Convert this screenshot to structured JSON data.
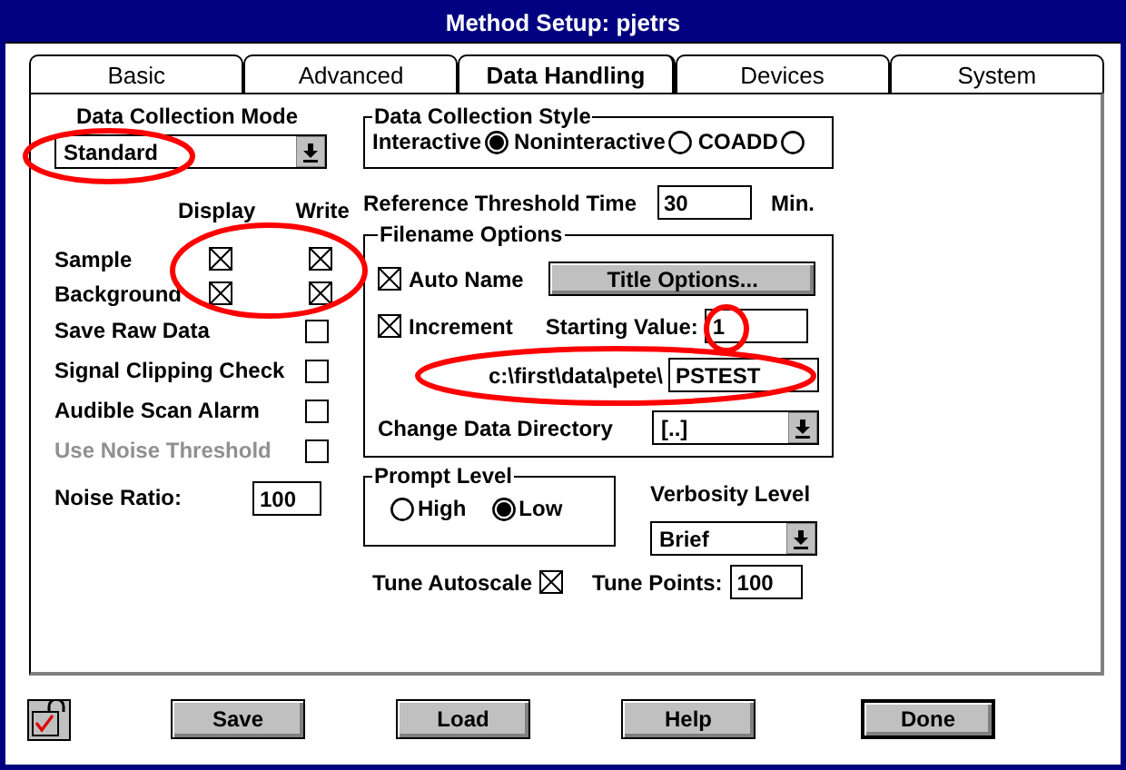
{
  "window": {
    "title": "Method Setup: pjetrs"
  },
  "tabs": [
    {
      "label": "Basic",
      "selected": false
    },
    {
      "label": "Advanced",
      "selected": false
    },
    {
      "label": "Data Handling",
      "selected": true
    },
    {
      "label": "Devices",
      "selected": false
    },
    {
      "label": "System",
      "selected": false
    }
  ],
  "data_collection_mode": {
    "label": "Data Collection Mode",
    "value": "Standard"
  },
  "columns": [
    "Display",
    "Write"
  ],
  "options": [
    {
      "kind": "pair",
      "label": "Sample",
      "display_checked": true,
      "write_checked": true
    },
    {
      "kind": "pair",
      "label": "Background",
      "display_checked": true,
      "write_checked": true
    },
    {
      "kind": "check",
      "label": "Save Raw Data",
      "checked": false,
      "disabled": false
    },
    {
      "kind": "check",
      "label": "Signal Clipping Check",
      "checked": false,
      "disabled": false
    },
    {
      "kind": "check",
      "label": "Audible Scan Alarm",
      "checked": false,
      "disabled": false
    },
    {
      "kind": "check",
      "label": "Use Noise Threshold",
      "checked": false,
      "disabled": true
    },
    {
      "kind": "input",
      "label": "Noise Ratio:",
      "value": "100"
    }
  ],
  "data_collection_style": {
    "title": "Data Collection Style",
    "options": [
      {
        "label": "Interactive",
        "selected": true
      },
      {
        "label": "Noninteractive",
        "selected": false
      },
      {
        "label": "COADD",
        "selected": false
      }
    ]
  },
  "reference_threshold": {
    "label": "Reference Threshold Time",
    "value": "30",
    "unit": "Min."
  },
  "filename_options": {
    "title": "Filename Options",
    "auto_name": {
      "label": "Auto Name",
      "checked": true
    },
    "title_options_button": "Title Options...",
    "increment": {
      "label": "Increment",
      "checked": true
    },
    "starting_value": {
      "label": "Starting Value:",
      "value": "1"
    },
    "path": "c:\\first\\data\\pete\\",
    "filename": "PSTEST",
    "change_directory": {
      "label": "Change Data Directory",
      "value": "[..]"
    }
  },
  "prompt_level": {
    "title": "Prompt Level",
    "options": [
      {
        "label": "High",
        "selected": false
      },
      {
        "label": "Low",
        "selected": true
      }
    ]
  },
  "verbosity_level": {
    "label": "Verbosity Level",
    "value": "Brief"
  },
  "tune_autoscale": {
    "label": "Tune Autoscale",
    "checked": true
  },
  "tune_points": {
    "label": "Tune Points:",
    "value": "100"
  },
  "buttons": [
    {
      "label": "Save",
      "default": false
    },
    {
      "label": "Load",
      "default": false
    },
    {
      "label": "Help",
      "default": false
    },
    {
      "label": "Done",
      "default": true
    }
  ]
}
